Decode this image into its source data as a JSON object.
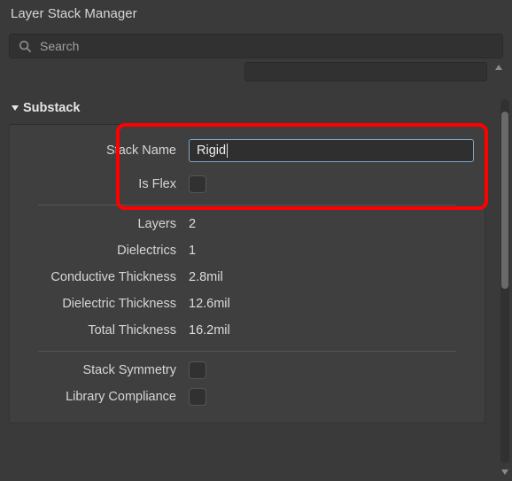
{
  "window": {
    "title": "Layer Stack Manager"
  },
  "search": {
    "placeholder": "Search"
  },
  "section": {
    "title": "Substack"
  },
  "substack": {
    "labels": {
      "stack_name": "Stack Name",
      "is_flex": "Is Flex",
      "layers": "Layers",
      "dielectrics": "Dielectrics",
      "conductive_thickness": "Conductive Thickness",
      "dielectric_thickness": "Dielectric Thickness",
      "total_thickness": "Total Thickness",
      "stack_symmetry": "Stack Symmetry",
      "library_compliance": "Library Compliance"
    },
    "values": {
      "stack_name": "Rigid",
      "is_flex": false,
      "layers": "2",
      "dielectrics": "1",
      "conductive_thickness": "2.8mil",
      "dielectric_thickness": "12.6mil",
      "total_thickness": "16.2mil",
      "stack_symmetry": false,
      "library_compliance": false
    }
  }
}
